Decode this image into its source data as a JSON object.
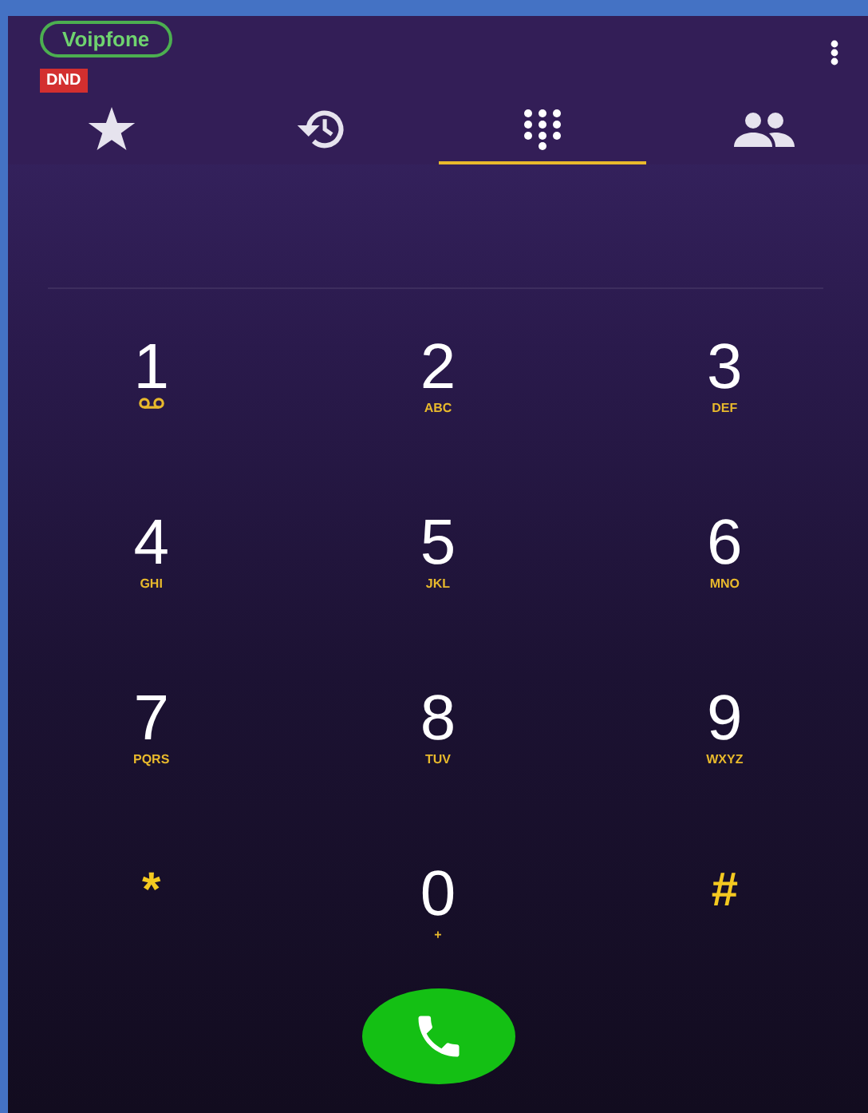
{
  "account": {
    "label": "Voipfone"
  },
  "status_badge": "DND",
  "tabs": [
    {
      "kind": "favorites",
      "selected": false
    },
    {
      "kind": "recents",
      "selected": false
    },
    {
      "kind": "keypad",
      "selected": true
    },
    {
      "kind": "contacts",
      "selected": false
    }
  ],
  "keys": [
    {
      "kind": "voicemail",
      "digit": "1"
    },
    {
      "kind": "digit",
      "digit": "2",
      "letters": "ABC"
    },
    {
      "kind": "digit",
      "digit": "3",
      "letters": "DEF"
    },
    {
      "kind": "digit",
      "digit": "4",
      "letters": "GHI"
    },
    {
      "kind": "digit",
      "digit": "5",
      "letters": "JKL"
    },
    {
      "kind": "digit",
      "digit": "6",
      "letters": "MNO"
    },
    {
      "kind": "digit",
      "digit": "7",
      "letters": "PQRS"
    },
    {
      "kind": "digit",
      "digit": "8",
      "letters": "TUV"
    },
    {
      "kind": "digit",
      "digit": "9",
      "letters": "WXYZ"
    },
    {
      "kind": "symbol",
      "digit": "*"
    },
    {
      "kind": "digit",
      "digit": "0",
      "letters": "+"
    },
    {
      "kind": "symbol",
      "digit": "#"
    }
  ]
}
